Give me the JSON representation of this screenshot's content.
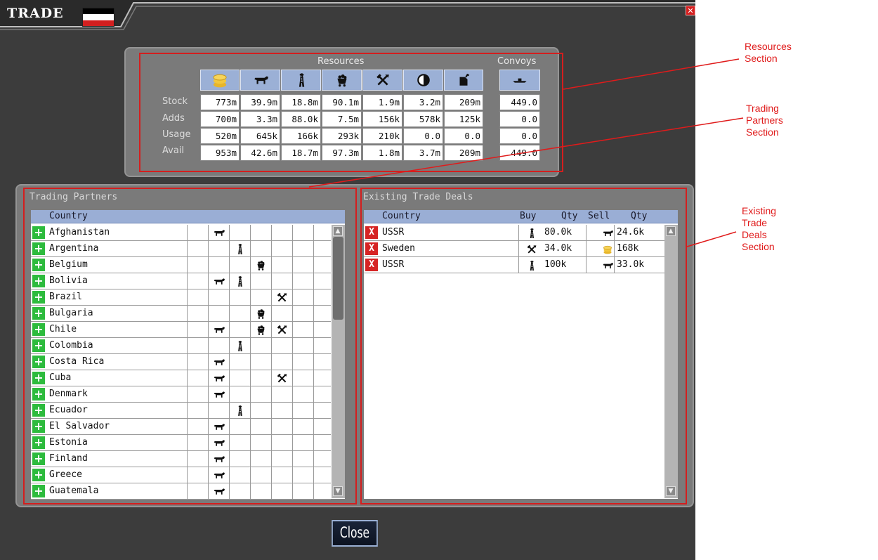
{
  "window": {
    "title": "TRADE",
    "close_glyph": "✕",
    "flag_colors": [
      "#000000",
      "#ffffff",
      "#d21f1f"
    ]
  },
  "resources": {
    "header_resources": "Resources",
    "header_convoys": "Convoys",
    "icons": [
      "money-icon",
      "cattle-icon",
      "oil-derrick-icon",
      "coal-cart-icon",
      "mining-tools-icon",
      "rare-materials-icon",
      "fuel-can-icon"
    ],
    "convoy_icon": "convoy-ship-icon",
    "rows": [
      {
        "label": "Stock",
        "values": [
          "773m",
          "39.9m",
          "18.8m",
          "90.1m",
          "1.9m",
          "3.2m",
          "209m"
        ],
        "convoys": "449.0"
      },
      {
        "label": "Adds",
        "values": [
          "700m",
          "3.3m",
          "88.0k",
          "7.5m",
          "156k",
          "578k",
          "125k"
        ],
        "convoys": "0.0"
      },
      {
        "label": "Usage",
        "values": [
          "520m",
          "645k",
          "166k",
          "293k",
          "210k",
          "0.0",
          "0.0"
        ],
        "convoys": "0.0"
      },
      {
        "label": "Avail",
        "values": [
          "953m",
          "42.6m",
          "18.7m",
          "97.3m",
          "1.8m",
          "3.7m",
          "209m"
        ],
        "convoys": "449.0"
      }
    ]
  },
  "trading_partners": {
    "title": "Trading Partners",
    "column_header": "Country",
    "rows": [
      {
        "name": "Afghanistan",
        "icons": [
          null,
          "cattle",
          null,
          null,
          null,
          null,
          null
        ]
      },
      {
        "name": "Argentina",
        "icons": [
          null,
          null,
          "oil",
          null,
          null,
          null,
          null
        ]
      },
      {
        "name": "Belgium",
        "icons": [
          null,
          null,
          null,
          "coal",
          null,
          null,
          null
        ]
      },
      {
        "name": "Bolivia",
        "icons": [
          null,
          "cattle",
          "oil",
          null,
          null,
          null,
          null
        ]
      },
      {
        "name": "Brazil",
        "icons": [
          null,
          null,
          null,
          null,
          "tools",
          null,
          null
        ]
      },
      {
        "name": "Bulgaria",
        "icons": [
          null,
          null,
          null,
          "coal",
          null,
          null,
          null
        ]
      },
      {
        "name": "Chile",
        "icons": [
          null,
          "cattle",
          null,
          "coal",
          "tools",
          null,
          null
        ]
      },
      {
        "name": "Colombia",
        "icons": [
          null,
          null,
          "oil",
          null,
          null,
          null,
          null
        ]
      },
      {
        "name": "Costa Rica",
        "icons": [
          null,
          "cattle",
          null,
          null,
          null,
          null,
          null
        ]
      },
      {
        "name": "Cuba",
        "icons": [
          null,
          "cattle",
          null,
          null,
          "tools",
          null,
          null
        ]
      },
      {
        "name": "Denmark",
        "icons": [
          null,
          "cattle",
          null,
          null,
          null,
          null,
          null
        ]
      },
      {
        "name": "Ecuador",
        "icons": [
          null,
          null,
          "oil",
          null,
          null,
          null,
          null
        ]
      },
      {
        "name": "El Salvador",
        "icons": [
          null,
          "cattle",
          null,
          null,
          null,
          null,
          null
        ]
      },
      {
        "name": "Estonia",
        "icons": [
          null,
          "cattle",
          null,
          null,
          null,
          null,
          null
        ]
      },
      {
        "name": "Finland",
        "icons": [
          null,
          "cattle",
          null,
          null,
          null,
          null,
          null
        ]
      },
      {
        "name": "Greece",
        "icons": [
          null,
          "cattle",
          null,
          null,
          null,
          null,
          null
        ]
      },
      {
        "name": "Guatemala",
        "icons": [
          null,
          "cattle",
          null,
          null,
          null,
          null,
          null
        ]
      }
    ]
  },
  "trade_deals": {
    "title": "Existing Trade Deals",
    "headers": {
      "country": "Country",
      "buy": "Buy",
      "qty": "Qty",
      "sell": "Sell",
      "qty2": "Qty"
    },
    "rows": [
      {
        "country": "USSR",
        "buy_icon": "oil",
        "buy_qty": "80.0k",
        "sell_icon": "cattle",
        "sell_qty": "24.6k"
      },
      {
        "country": "Sweden",
        "buy_icon": "tools",
        "buy_qty": "34.0k",
        "sell_icon": "money",
        "sell_qty": "168k"
      },
      {
        "country": "USSR",
        "buy_icon": "oil",
        "buy_qty": "100k",
        "sell_icon": "cattle",
        "sell_qty": "33.0k"
      }
    ]
  },
  "close_label": "Close",
  "annotations": {
    "resources": "Resources\nSection",
    "partners": "Trading\nPartners\nSection",
    "deals": "Existing\nTrade\nDeals\nSection"
  },
  "colors": {
    "highlight": "#d41e1e",
    "add": "#2dbb3d",
    "remove": "#d62424",
    "header_blue": "#9aaed5"
  }
}
